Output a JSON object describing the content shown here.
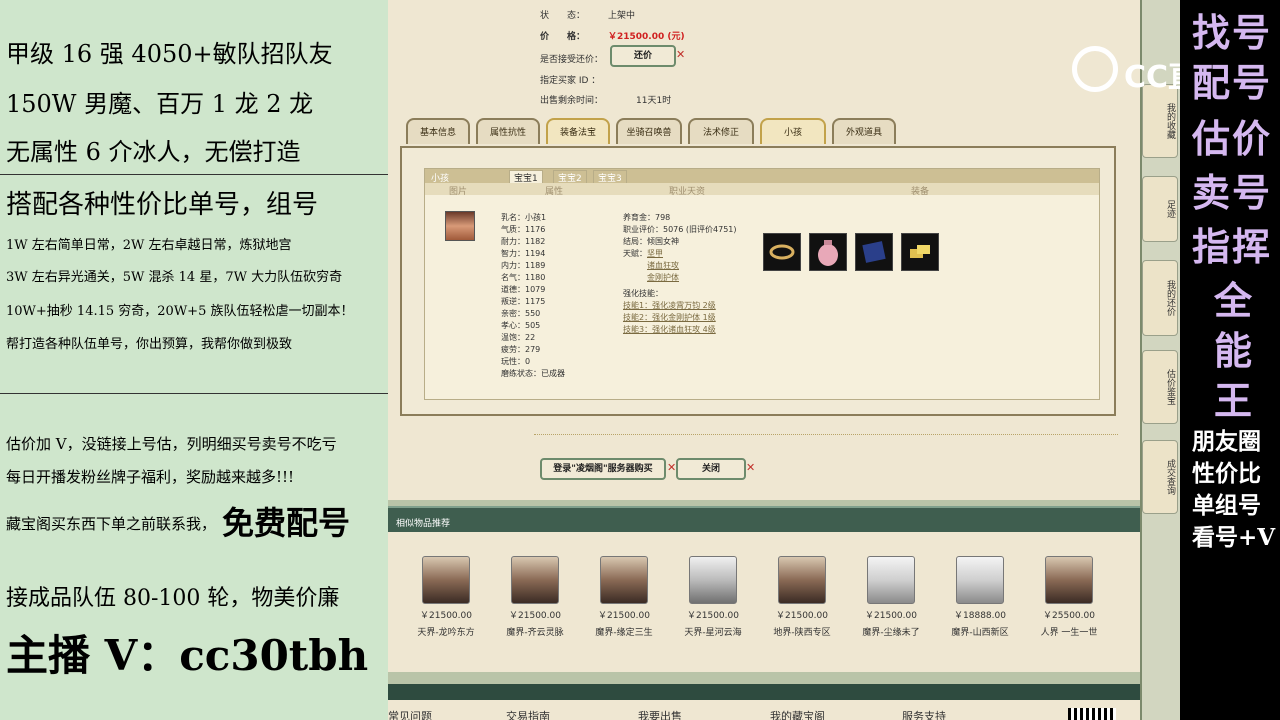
{
  "left_panel": {
    "lines": [
      "甲级 16 强 4050+敏队招队友",
      "150W 男魔、百万 1 龙 2 龙",
      "无属性 6 介冰人，无偿打造",
      "搭配各种性价比单号，组号",
      "1W 左右简单日常，2W 左右卓越日常，炼狱地宫",
      "3W 左右异光通关，5W 混杀 14 星，7W 大力队伍砍穷奇",
      "10W+抽秒 14.15 穷奇，20W+5 族队伍轻松虐一切副本！",
      "帮打造各种队伍单号，你出预算，我帮你做到极致",
      "估价加 V，没链接上号估，列明细买号卖号不吃亏",
      "每日开播发粉丝牌子福利，奖励越来越多!!!",
      "藏宝阁买东西下单之前联系我，",
      "免费配号",
      "接成品队伍 80-100 轮，物美价廉",
      "主播 V：cc30tbh"
    ]
  },
  "trade_info": {
    "status_label": "状　　态：",
    "status_value": "上架中",
    "price_label": "价　　格：",
    "price_value": "￥21500.00 (元)",
    "counter_label": "是否接受还价：",
    "counter_button": "还价",
    "buyer_label": "指定买家 ID ：",
    "time_label": "出售剩余时间：",
    "time_value": "11天1时"
  },
  "tabs": [
    "基本信息",
    "属性抗性",
    "装备法宝",
    "坐骑召唤兽",
    "法术修正",
    "小孩",
    "外观道具"
  ],
  "active_tab": "小孩",
  "pet_panel": {
    "title": "小孩",
    "subtabs": [
      "宝宝1",
      "宝宝2",
      "宝宝3"
    ],
    "col_headers": [
      "图片",
      "属性",
      "职业天资",
      "装备"
    ],
    "stats": [
      "乳名：小孩1",
      "气质：1176",
      "耐力：1182",
      "智力：1194",
      "内力：1189",
      "名气：1180",
      "道德：1079",
      "叛逆：1175",
      "亲密：550",
      "孝心：505",
      "温饱：22",
      "疲劳：279",
      "玩性：0",
      "磨练状态：已成器"
    ],
    "career": {
      "money": "养育金：798",
      "rating": "职业评价：5076 (旧评价4751)",
      "ending": "结局：倾国女神",
      "talent_label": "天赋：",
      "talents": [
        "坚甲",
        "诸血狂攻",
        "金刚护体"
      ],
      "skill_label": "强化技能：",
      "skills": [
        "技能1：强化凌霄万钧 2级",
        "技能2：强化金刚护体 1级",
        "技能3：强化诸血狂攻 4级"
      ]
    },
    "equip_icons": [
      "ring-icon",
      "pouch-icon",
      "book-icon",
      "gold-icon"
    ]
  },
  "actions": {
    "buy_button": "登录\"凌烟阁\"服务器购买",
    "close_button": "关闭"
  },
  "recommend": {
    "title": "相似物品推荐",
    "items": [
      {
        "price": "￥21500.00",
        "server": "天界-龙吟东方"
      },
      {
        "price": "￥21500.00",
        "server": "魔界-齐云灵脉"
      },
      {
        "price": "￥21500.00",
        "server": "魔界-缘定三生"
      },
      {
        "price": "￥21500.00",
        "server": "天界-星河云海"
      },
      {
        "price": "￥21500.00",
        "server": "地界-陕西专区"
      },
      {
        "price": "￥21500.00",
        "server": "魔界-尘缘未了"
      },
      {
        "price": "￥18888.00",
        "server": "魔界-山西新区"
      },
      {
        "price": "￥25500.00",
        "server": "人界 一生一世"
      }
    ]
  },
  "side_nav": [
    "我的收藏",
    "足迹",
    "我的还价",
    "估价鉴宝",
    "成交查询"
  ],
  "bottom_nav": [
    "常见问题",
    "交易指南",
    "我要出售",
    "我的藏宝阁",
    "服务支持"
  ],
  "watermark": "CC直播",
  "right_panel": {
    "big_lines": [
      "找号",
      "配号",
      "估价",
      "卖号",
      "指挥",
      "全",
      "能",
      "王"
    ],
    "small_lines": [
      "朋友圈",
      "性价比",
      "单组号",
      "看号+V"
    ]
  }
}
